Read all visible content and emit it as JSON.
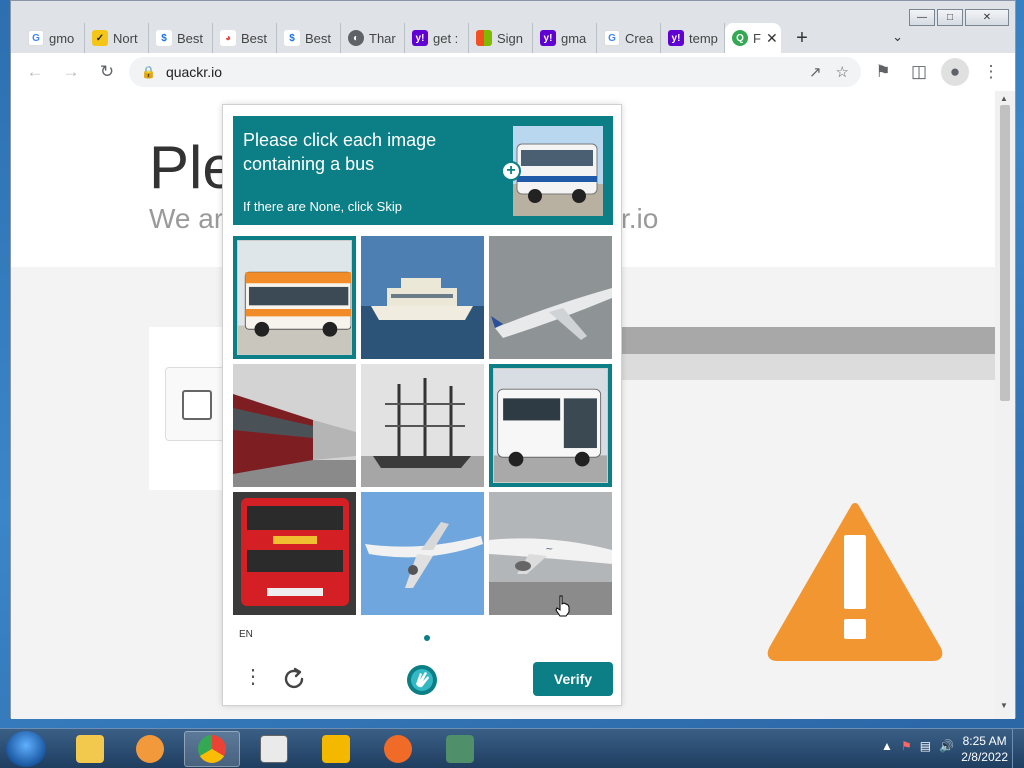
{
  "browser": {
    "tabs": [
      {
        "label": "gmo",
        "icon": "google-icon",
        "color": "#ffffff"
      },
      {
        "label": "Nort",
        "icon": "norton-icon",
        "color": "#f5c518"
      },
      {
        "label": "Best",
        "icon": "dollar-icon",
        "color": "#1a73e8"
      },
      {
        "label": "Best",
        "icon": "rainbow-icon",
        "color": "#e84a4a"
      },
      {
        "label": "Best",
        "icon": "dollar-icon",
        "color": "#1a73e8"
      },
      {
        "label": "Thar",
        "icon": "globe-icon",
        "color": "#5f6368"
      },
      {
        "label": "get :",
        "icon": "yahoo-icon",
        "color": "#6001d2"
      },
      {
        "label": "Sign",
        "icon": "microsoft-icon",
        "color": "#f25022"
      },
      {
        "label": "gma",
        "icon": "yahoo-icon",
        "color": "#6001d2"
      },
      {
        "label": "Crea",
        "icon": "google-icon",
        "color": "#ffffff"
      },
      {
        "label": "temp",
        "icon": "yahoo-icon",
        "color": "#6001d2"
      },
      {
        "label": "F",
        "icon": "quackr-icon",
        "color": "#34a853",
        "active": true
      }
    ],
    "newtab": "+",
    "url": "quackr.io"
  },
  "page": {
    "title": "Ple",
    "subtitle": "We ar",
    "subtitle_right": "kr.io"
  },
  "captcha": {
    "prompt": "Please click each image containing a bus",
    "hint": "If there are None, click Skip",
    "language": "EN",
    "verify_label": "Verify",
    "cells": [
      {
        "subject": "orange-bus",
        "selected": true
      },
      {
        "subject": "ferry-boat",
        "selected": false
      },
      {
        "subject": "airplane",
        "selected": false
      },
      {
        "subject": "train",
        "selected": false
      },
      {
        "subject": "sailing-ship",
        "selected": false
      },
      {
        "subject": "white-bus",
        "selected": true
      },
      {
        "subject": "red-double-decker-bus",
        "selected": false
      },
      {
        "subject": "airplane",
        "selected": false
      },
      {
        "subject": "airplane",
        "selected": false
      }
    ],
    "accent_color": "#0b7e86"
  },
  "taskbar": {
    "apps": [
      "windows-explorer",
      "media-player",
      "chrome",
      "notepad",
      "smiley-app",
      "xr-app",
      "system-monitor"
    ],
    "time": "8:25 AM",
    "date": "2/8/2022"
  }
}
